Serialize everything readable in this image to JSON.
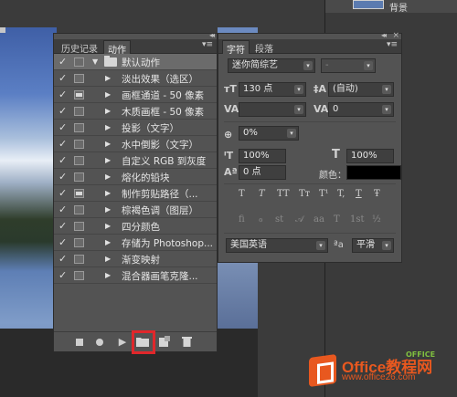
{
  "layers_panel": {
    "layer_name": "背景"
  },
  "actions_panel": {
    "tabs": [
      "历史记录",
      "动作"
    ],
    "collapse": "◂◂",
    "menu": "▾≡",
    "set": {
      "label": "默认动作"
    },
    "actions": [
      "淡出效果（选区）",
      "画框通道 - 50 像素",
      "木质画框 - 50 像素",
      "投影（文字）",
      "水中倒影（文字）",
      "自定义 RGB 到灰度",
      "熔化的铅块",
      "制作剪贴路径（...",
      "棕褐色调（图层）",
      "四分颜色",
      "存储为 Photoshop...",
      "渐变映射",
      "混合器画笔克隆..."
    ],
    "checkmark": "✓",
    "expand_arrow": "▶",
    "collapse_arrow": "▼",
    "bottom_buttons": {
      "stop": "",
      "record": "",
      "play": "▶",
      "new_set": "",
      "new_action": "",
      "delete": "🗑"
    }
  },
  "character_panel": {
    "tabs": [
      "字符",
      "段落"
    ],
    "collapse": "◂◂",
    "close": "×",
    "menu": "▾≡",
    "font_family": "迷你简综艺",
    "font_style": "-",
    "font_size": "130 点",
    "leading": "(自动)",
    "kerning": "",
    "tracking": "0",
    "scale_percent": "0%",
    "vertical_scale": "100%",
    "horizontal_scale": "100%",
    "baseline_shift": "0 点",
    "color_label": "颜色：",
    "color_value": "#000000",
    "style_buttons": [
      "T",
      "T",
      "TT",
      "Tᴛ",
      "T¹",
      "T,",
      "T",
      "Ŧ"
    ],
    "opentype_buttons": [
      "fi",
      "ℴ",
      "st",
      "𝒜",
      "aa",
      "T",
      "1st",
      "½"
    ],
    "language": "美国英语",
    "antialias_prefix": "ªa",
    "antialias": "平滑"
  },
  "watermark": {
    "brand": "Office教程网",
    "url": "www.office26.com",
    "tag": "OFFICE"
  }
}
